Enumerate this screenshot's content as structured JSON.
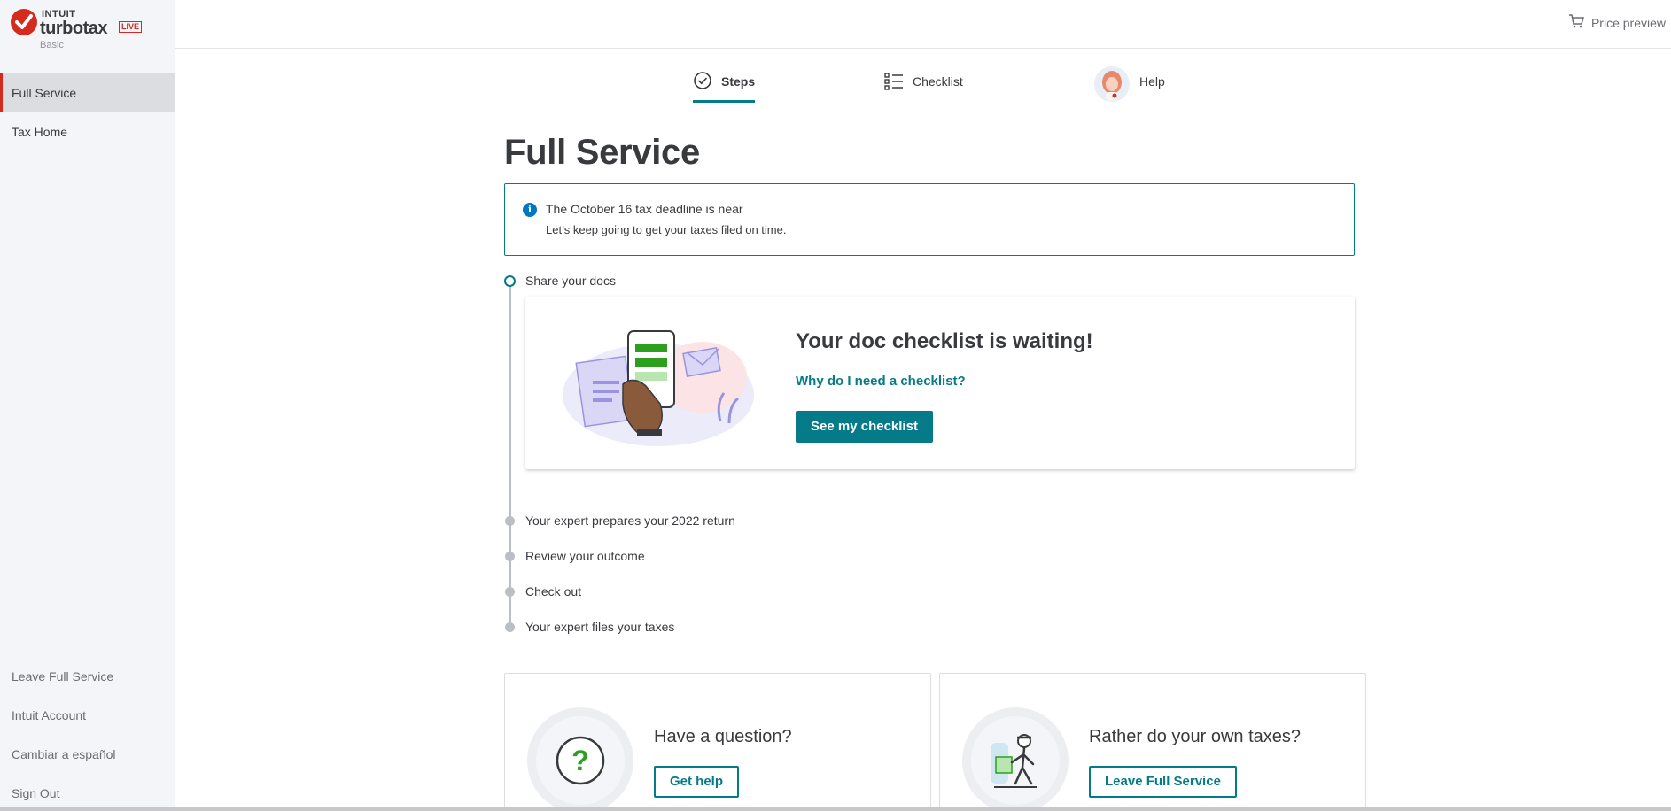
{
  "brand": {
    "company": "INTUIT",
    "product": "turbotax",
    "badge": "LIVE",
    "tier": "Basic",
    "accent_color": "#d52b1e",
    "teal": "#057b8a"
  },
  "sidebar": {
    "items": [
      {
        "label": "Full Service",
        "active": true
      },
      {
        "label": "Tax Home",
        "active": false
      }
    ],
    "footer_links": [
      "Leave Full Service",
      "Intuit Account",
      "Cambiar a español",
      "Sign Out"
    ]
  },
  "header": {
    "price_preview_label": "Price preview",
    "price_preview_icon": "cart-icon"
  },
  "tabs": [
    {
      "label": "Steps",
      "icon": "check-circle-icon",
      "active": true
    },
    {
      "label": "Checklist",
      "icon": "list-icon",
      "active": false
    },
    {
      "label": "Help",
      "icon": "avatar-icon",
      "active": false
    }
  ],
  "page_title": "Full Service",
  "alert": {
    "icon": "info-icon",
    "title": "The October 16 tax deadline is near",
    "text": "Let’s keep going to get your taxes filed on time."
  },
  "steps": [
    {
      "label": "Share your docs",
      "current": true
    },
    {
      "label": "Your expert prepares your 2022 return",
      "current": false
    },
    {
      "label": "Review your outcome",
      "current": false
    },
    {
      "label": "Check out",
      "current": false
    },
    {
      "label": "Your expert files your taxes",
      "current": false
    }
  ],
  "doc_card": {
    "title": "Your doc checklist is waiting!",
    "link": "Why do I need a checklist?",
    "button": "See my checklist"
  },
  "bottom_cards": [
    {
      "title": "Have a question?",
      "button": "Get help",
      "icon": "question-icon"
    },
    {
      "title": "Rather do your own taxes?",
      "button": "Leave Full Service",
      "icon": "delivery-person-icon"
    }
  ]
}
